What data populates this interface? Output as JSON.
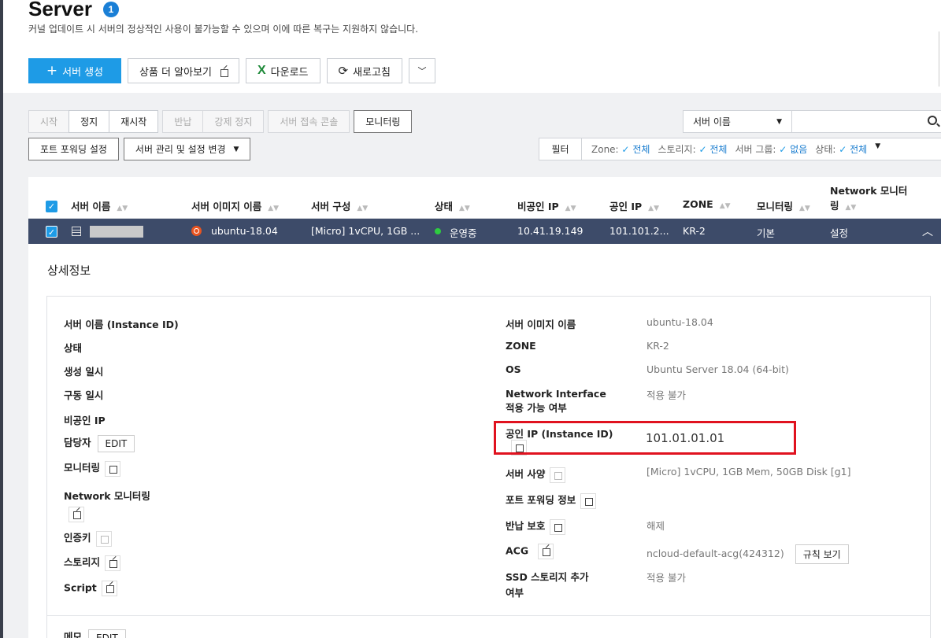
{
  "page": {
    "title": "Server",
    "badge": "1",
    "subtitle": "커널 업데이트 시 서버의 정상적인 사용이 불가능할 수 있으며 이에 따른 복구는 지원하지 않습니다."
  },
  "top_actions": {
    "create": "서버 생성",
    "learn_more": "상품 더 알아보기",
    "download": "다운로드",
    "refresh": "새로고침"
  },
  "toolbar": {
    "start": "시작",
    "stop": "정지",
    "restart": "재시작",
    "return": "반납",
    "force_stop": "강제 정지",
    "console": "서버 접속 콘솔",
    "monitoring": "모니터링",
    "port_forwarding": "포트 포워딩 설정",
    "server_manage": "서버 관리 및 설정 변경"
  },
  "search": {
    "select_value": "서버 이름"
  },
  "filter": {
    "label": "필터",
    "zone_label": "Zone:",
    "zone_value": "전체",
    "storage_label": "스토리지:",
    "storage_value": "전체",
    "group_label": "서버 그룹:",
    "group_value": "없음",
    "status_label": "상태:",
    "status_value": "전체"
  },
  "table": {
    "headers": [
      "서버 이름",
      "서버 이미지 이름",
      "서버 구성",
      "상태",
      "비공인 IP",
      "공인 IP",
      "ZONE",
      "모니터링",
      "Network 모니터",
      "링"
    ],
    "row": {
      "image": "ubuntu-18.04",
      "spec": "[Micro] 1vCPU, 1GB ...",
      "status": "운영중",
      "private_ip": "10.41.19.149",
      "public_ip": "101.101.2...",
      "zone": "KR-2",
      "monitoring": "기본",
      "net_monitoring": "설정"
    }
  },
  "detail": {
    "title": "상세정보",
    "left": {
      "server_name": "서버 이름 (Instance ID)",
      "status": "상태",
      "created": "생성 일시",
      "running": "구동 일시",
      "private_ip": "비공인 IP",
      "manager": "담당자",
      "edit": "EDIT",
      "monitoring": "모니터링",
      "net_monitoring": "Network 모니터링",
      "auth_key": "인증키",
      "storage": "스토리지",
      "script": "Script"
    },
    "right": {
      "image_label": "서버 이미지 이름",
      "image_value": "ubuntu-18.04",
      "zone_label": "ZONE",
      "zone_value": "KR-2",
      "os_label": "OS",
      "os_value": "Ubuntu Server 18.04 (64-bit)",
      "nic_label_1": "Network Interface",
      "nic_label_2": "적용 가능 여부",
      "nic_value": "적용 불가",
      "public_ip_label": "공인 IP (Instance ID)",
      "public_ip_value": "101.01.01.01",
      "spec_label": "서버 사양",
      "spec_value": "[Micro] 1vCPU, 1GB Mem, 50GB Disk [g1]",
      "pf_label": "포트 포워딩 정보",
      "return_label": "반납 보호",
      "return_value": "해제",
      "acg_label": "ACG",
      "acg_value": "ncloud-default-acg(424312)",
      "acg_rules": "규칙 보기",
      "ssd_label_1": "SSD 스토리지 추가",
      "ssd_label_2": "여부",
      "ssd_value": "적용 불가"
    },
    "memo": "메모",
    "memo_edit": "EDIT"
  },
  "colors": {
    "primary": "#1e9be6",
    "selected_row": "#3d4b69",
    "highlight_box": "#e0121f",
    "status_running": "#2ecc40"
  }
}
